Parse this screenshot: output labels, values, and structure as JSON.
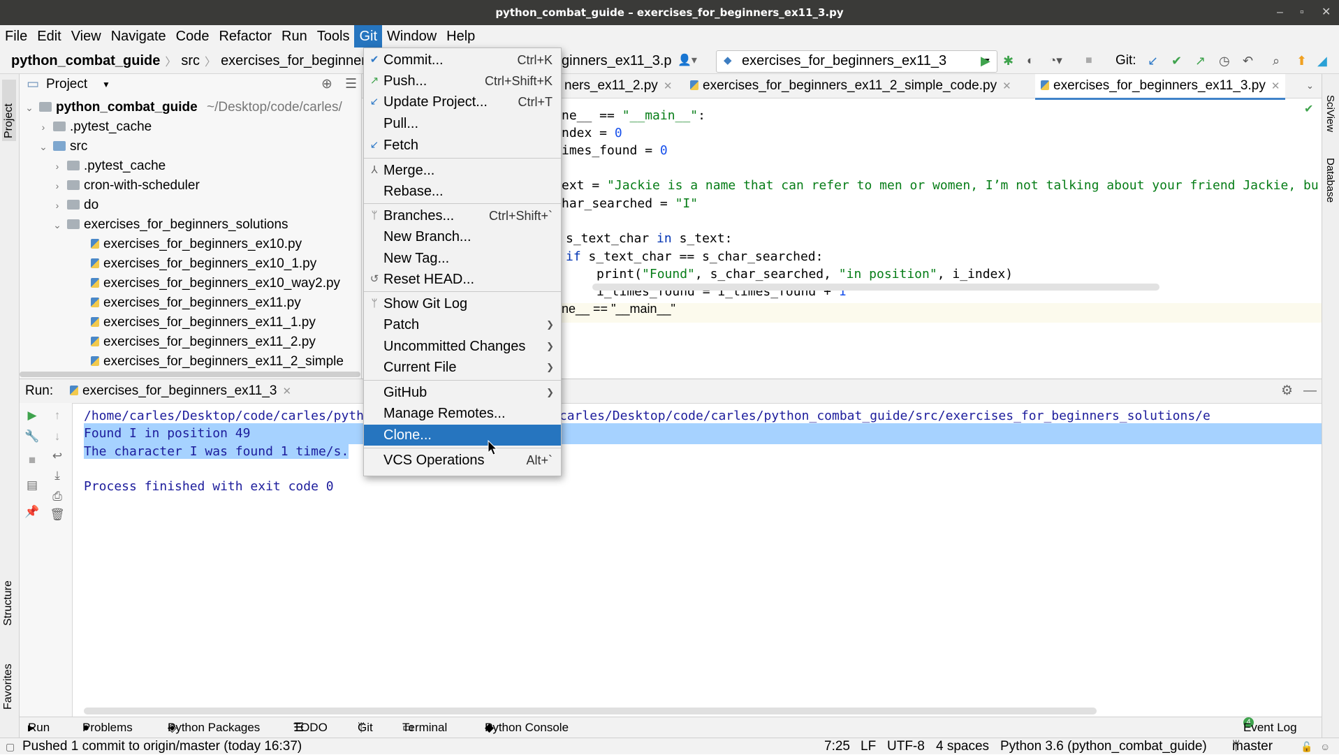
{
  "window": {
    "title": "python_combat_guide – exercises_for_beginners_ex11_3.py"
  },
  "menubar": [
    "File",
    "Edit",
    "View",
    "Navigate",
    "Code",
    "Refactor",
    "Run",
    "Tools",
    "Git",
    "Window",
    "Help"
  ],
  "navbar": {
    "project": "python_combat_guide",
    "src": "src",
    "folder": "exercises_for_beginners",
    "file_partial": "ginners_ex11_3.p",
    "run_config": "exercises_for_beginners_ex11_3",
    "git_label": "Git:"
  },
  "project_panel": {
    "title": "Project",
    "root": "python_combat_guide",
    "root_path": "~/Desktop/code/carles/",
    "items": [
      {
        "label": ".pytest_cache"
      },
      {
        "label": "src"
      },
      {
        "label": ".pytest_cache"
      },
      {
        "label": "cron-with-scheduler"
      },
      {
        "label": "do"
      },
      {
        "label": "exercises_for_beginners_solutions"
      },
      {
        "label": "exercises_for_beginners_ex10.py"
      },
      {
        "label": "exercises_for_beginners_ex10_1.py"
      },
      {
        "label": "exercises_for_beginners_ex10_way2.py"
      },
      {
        "label": "exercises_for_beginners_ex11.py"
      },
      {
        "label": "exercises_for_beginners_ex11_1.py"
      },
      {
        "label": "exercises_for_beginners_ex11_2.py"
      },
      {
        "label": "exercises_for_beginners_ex11_2_simple"
      }
    ]
  },
  "editor": {
    "tabs": [
      {
        "label": "ners_ex11_2.py"
      },
      {
        "label": "exercises_for_beginners_ex11_2_simple_code.py"
      },
      {
        "label": "exercises_for_beginners_ex11_3.py"
      }
    ],
    "lines": [
      {
        "a": "ne__ == ",
        "b": "\"__main__\"",
        "c": ":"
      },
      {
        "a": "ndex = ",
        "b": "0"
      },
      {
        "a": "imes_found = ",
        "b": "0"
      },
      {
        "a": "ext = ",
        "b": "\"Jackie is a name that can refer to men or women, I’m not talking about your friend Jackie, bu"
      },
      {
        "a": "har_searched = ",
        "b": "\"I\""
      },
      {
        "a": "s_text_char ",
        "k": "in",
        "c": " s_text:"
      },
      {
        "k": "if",
        "c": " s_text_char == s_char_searched:"
      },
      {
        "a": "print(",
        "b": "\"Found\"",
        "c": ", s_char_searched, ",
        "d": "\"in position\"",
        "e": ", i_index)"
      },
      {
        "a": "i_times_found = i_times_found + ",
        "b": "1"
      }
    ],
    "breadcrumb": "ne__ == \"__main__\""
  },
  "run_panel": {
    "label": "Run:",
    "tab": "exercises_for_beginners_ex11_3",
    "cmd_left": "/home/carles/Desktop/code/carles/pyth",
    "cmd_right": "python /home/carles/Desktop/code/carles/python_combat_guide/src/exercises_for_beginners_solutions/e",
    "output": [
      "Found I in position 49",
      "The character I was found 1 time/s.",
      "",
      "Process finished with exit code 0"
    ]
  },
  "git_menu": {
    "items": [
      {
        "label": "Commit...",
        "shortcut": "Ctrl+K",
        "icon": "check-icon"
      },
      {
        "label": "Push...",
        "shortcut": "Ctrl+Shift+K",
        "icon": "push-arrow-icon"
      },
      {
        "label": "Update Project...",
        "shortcut": "Ctrl+T",
        "icon": "update-arrow-icon"
      },
      {
        "label": "Pull..."
      },
      {
        "label": "Fetch",
        "icon": "fetch-arrow-icon"
      },
      {
        "label": "Merge...",
        "icon": "merge-icon"
      },
      {
        "label": "Rebase..."
      },
      {
        "label": "Branches...",
        "shortcut": "Ctrl+Shift+`",
        "icon": "branch-icon"
      },
      {
        "label": "New Branch..."
      },
      {
        "label": "New Tag..."
      },
      {
        "label": "Reset HEAD...",
        "icon": "reset-icon"
      },
      {
        "label": "Show Git Log",
        "icon": "branch-icon"
      },
      {
        "label": "Patch"
      },
      {
        "label": "Uncommitted Changes"
      },
      {
        "label": "Current File"
      },
      {
        "label": "GitHub"
      },
      {
        "label": "Manage Remotes..."
      },
      {
        "label": "Clone..."
      },
      {
        "label": "VCS Operations",
        "shortcut": "Alt+`"
      }
    ]
  },
  "bottom_tabs": [
    "Run",
    "Problems",
    "Python Packages",
    "TODO",
    "Git",
    "Terminal",
    "Python Console",
    "Event Log"
  ],
  "event_log_badge": "4",
  "left_stripe": [
    "Project",
    "Structure",
    "Favorites"
  ],
  "right_stripe": [
    "SciView",
    "Database"
  ],
  "statusbar": {
    "message": "Pushed 1 commit to origin/master (today 16:37)",
    "position": "7:25",
    "line_ending": "LF",
    "encoding": "UTF-8",
    "indent": "4 spaces",
    "interpreter": "Python 3.6 (python_combat_guide)",
    "branch": "master"
  },
  "colors": {
    "accent": "#2675bf",
    "selection": "#a6d2ff",
    "string": "#067d17",
    "number": "#1750eb",
    "keyword": "#0033b3"
  }
}
